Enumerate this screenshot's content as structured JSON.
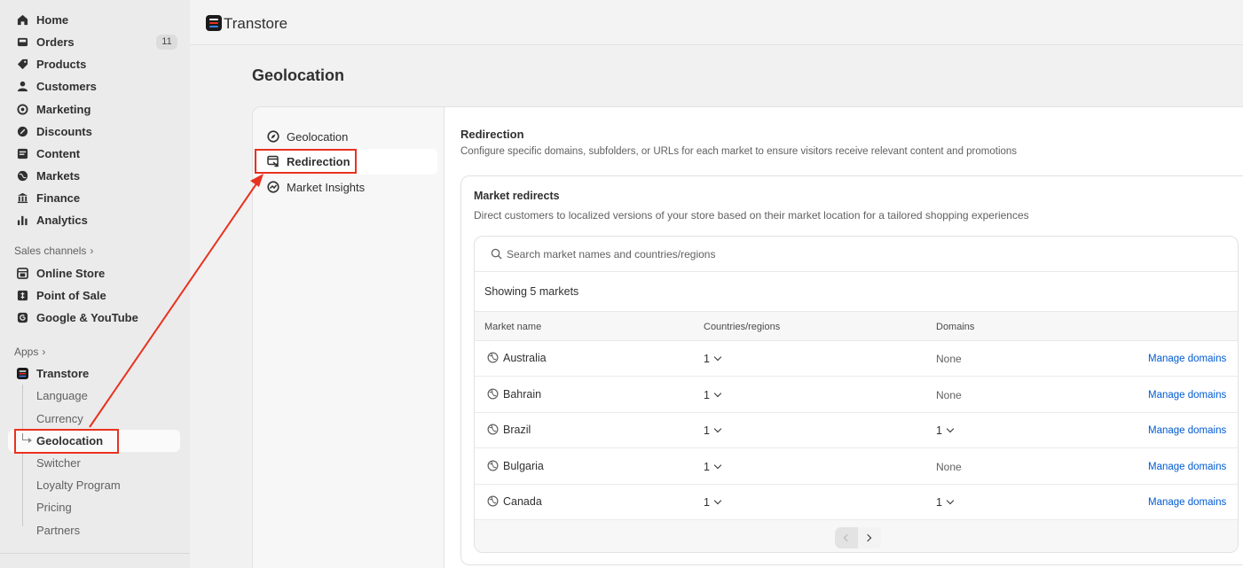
{
  "app": {
    "name": "Transtore"
  },
  "sidebar": {
    "items": [
      {
        "label": "Home",
        "icon": "home-icon"
      },
      {
        "label": "Orders",
        "icon": "orders-icon",
        "badge": "11"
      },
      {
        "label": "Products",
        "icon": "tag-icon"
      },
      {
        "label": "Customers",
        "icon": "person-icon"
      },
      {
        "label": "Marketing",
        "icon": "target-icon"
      },
      {
        "label": "Discounts",
        "icon": "discount-icon"
      },
      {
        "label": "Content",
        "icon": "content-icon"
      },
      {
        "label": "Markets",
        "icon": "globe-icon"
      },
      {
        "label": "Finance",
        "icon": "bank-icon"
      },
      {
        "label": "Analytics",
        "icon": "bar-chart-icon"
      }
    ],
    "sales_channels": {
      "header": "Sales channels",
      "items": [
        {
          "label": "Online Store",
          "icon": "store-icon"
        },
        {
          "label": "Point of Sale",
          "icon": "pos-icon"
        },
        {
          "label": "Google & YouTube",
          "icon": "google-icon"
        }
      ]
    },
    "apps": {
      "header": "Apps",
      "app_label": "Transtore",
      "sub_items": [
        "Language",
        "Currency",
        "Geolocation",
        "Switcher",
        "Loyalty Program",
        "Pricing",
        "Partners"
      ],
      "selected": "Geolocation"
    }
  },
  "page": {
    "title": "Geolocation"
  },
  "panel_nav": {
    "items": [
      {
        "label": "Geolocation",
        "icon": "compass-icon"
      },
      {
        "label": "Redirection",
        "icon": "redirect-icon"
      },
      {
        "label": "Market Insights",
        "icon": "insights-icon"
      }
    ],
    "active": "Redirection"
  },
  "content": {
    "title": "Redirection",
    "description": "Configure specific domains, subfolders, or URLs for each market to ensure visitors receive relevant content and promotions",
    "card": {
      "title": "Market redirects",
      "description": "Direct customers to localized versions of your store based on their market location for a tailored shopping experiences",
      "search_placeholder": "Search market names and countries/regions",
      "showing": "Showing 5 markets",
      "columns": [
        "Market name",
        "Countries/regions",
        "Domains"
      ],
      "rows": [
        {
          "name": "Australia",
          "countries": "1",
          "domains": "None",
          "action": "Manage domains"
        },
        {
          "name": "Bahrain",
          "countries": "1",
          "domains": "None",
          "action": "Manage domains"
        },
        {
          "name": "Brazil",
          "countries": "1",
          "domains": "1",
          "action": "Manage domains"
        },
        {
          "name": "Bulgaria",
          "countries": "1",
          "domains": "None",
          "action": "Manage domains"
        },
        {
          "name": "Canada",
          "countries": "1",
          "domains": "1",
          "action": "Manage domains"
        }
      ]
    }
  },
  "colors": {
    "annotation": "#e8321f",
    "link": "#005bd3"
  }
}
